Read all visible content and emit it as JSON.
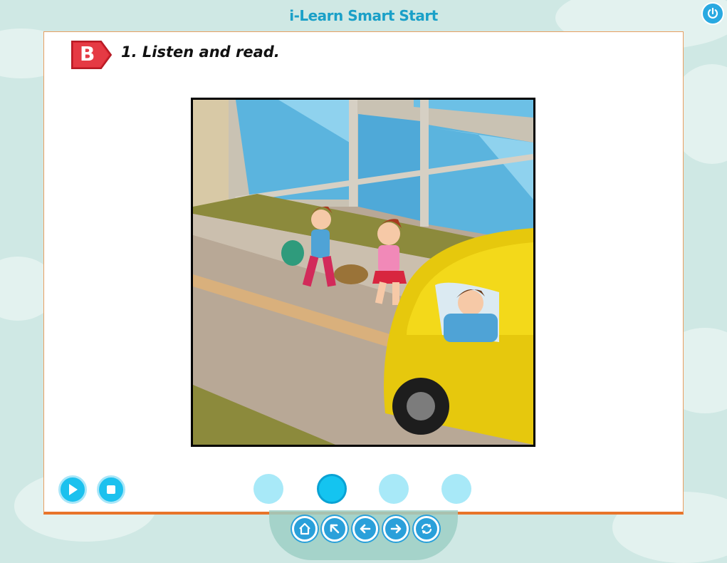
{
  "app": {
    "title": "i-Learn Smart Start"
  },
  "exercise": {
    "badge_letter": "B",
    "title": "1. Listen and read."
  },
  "icons": {
    "power": "power-icon",
    "play": "play-icon",
    "stop": "stop-icon",
    "home": "home-icon",
    "back": "arrow-up-left-icon",
    "previous": "arrow-left-icon",
    "next": "arrow-right-icon",
    "replay": "refresh-icon"
  },
  "pagination": {
    "count": 4,
    "active_index": 2
  },
  "colors": {
    "accent": "#1aa0c8",
    "badge": "#d8232f",
    "panel_border": "#e8742a",
    "dot_active": "#14c4f0",
    "dot_inactive": "#a8e9f8"
  }
}
